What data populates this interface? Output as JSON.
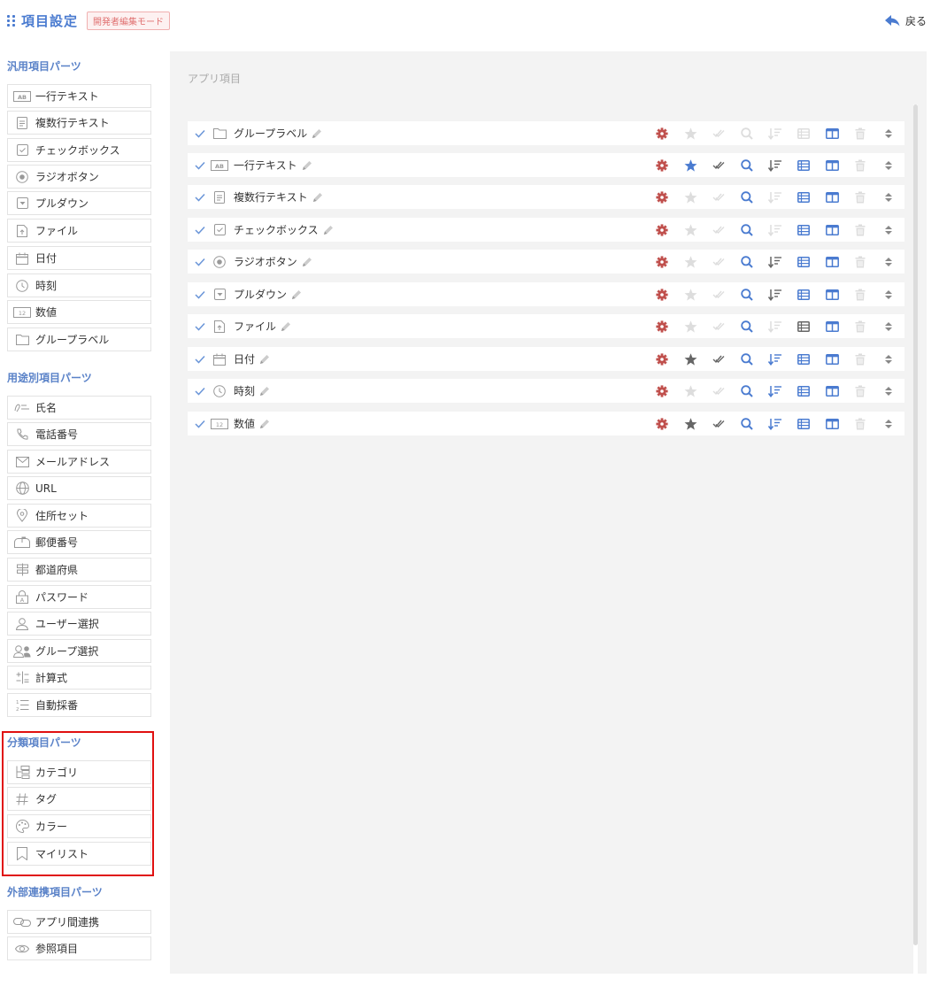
{
  "header": {
    "title": "項目設定",
    "mode_badge": "開発者編集モード",
    "back_label": "戻る"
  },
  "colors": {
    "accent": "#4a7bd0",
    "section": "#5a82c8",
    "gear": "#c0504d",
    "highlight": "#e01010",
    "icon_active": "#4a7bd0",
    "icon_dark": "#666666",
    "icon_disabled": "#dddddd"
  },
  "sidebar": {
    "sections": [
      {
        "title": "汎用項目パーツ",
        "items": [
          {
            "label": "一行テキスト",
            "icon": "text-line-icon"
          },
          {
            "label": "複数行テキスト",
            "icon": "multiline-text-icon"
          },
          {
            "label": "チェックボックス",
            "icon": "checkbox-icon"
          },
          {
            "label": "ラジオボタン",
            "icon": "radio-icon"
          },
          {
            "label": "プルダウン",
            "icon": "dropdown-icon"
          },
          {
            "label": "ファイル",
            "icon": "file-icon"
          },
          {
            "label": "日付",
            "icon": "calendar-icon"
          },
          {
            "label": "時刻",
            "icon": "clock-icon"
          },
          {
            "label": "数値",
            "icon": "number-icon"
          },
          {
            "label": "グループラベル",
            "icon": "folder-icon"
          }
        ]
      },
      {
        "title": "用途別項目パーツ",
        "items": [
          {
            "label": "氏名",
            "icon": "name-icon"
          },
          {
            "label": "電話番号",
            "icon": "phone-icon"
          },
          {
            "label": "メールアドレス",
            "icon": "mail-icon"
          },
          {
            "label": "URL",
            "icon": "globe-icon"
          },
          {
            "label": "住所セット",
            "icon": "location-icon"
          },
          {
            "label": "郵便番号",
            "icon": "postbox-icon"
          },
          {
            "label": "都道府県",
            "icon": "signpost-icon"
          },
          {
            "label": "パスワード",
            "icon": "password-icon"
          },
          {
            "label": "ユーザー選択",
            "icon": "user-icon"
          },
          {
            "label": "グループ選択",
            "icon": "group-icon"
          },
          {
            "label": "計算式",
            "icon": "calculator-icon"
          },
          {
            "label": "自動採番",
            "icon": "numbering-icon"
          }
        ]
      },
      {
        "title": "分類項目パーツ",
        "items": [
          {
            "label": "カテゴリ",
            "icon": "category-tree-icon"
          },
          {
            "label": "タグ",
            "icon": "hash-icon"
          },
          {
            "label": "カラー",
            "icon": "palette-icon"
          },
          {
            "label": "マイリスト",
            "icon": "bookmark-icon"
          }
        ]
      },
      {
        "title": "外部連携項目パーツ",
        "items": [
          {
            "label": "アプリ間連携",
            "icon": "link-icon"
          },
          {
            "label": "参照項目",
            "icon": "eye-icon"
          }
        ]
      }
    ]
  },
  "main": {
    "title": "アプリ項目",
    "fields": [
      {
        "label": "グループラベル",
        "icon": "folder-icon",
        "states": [
          "gear",
          "off",
          "off",
          "off",
          "off",
          "off",
          "on",
          "off",
          "sort"
        ]
      },
      {
        "label": "一行テキスト",
        "icon": "text-line-icon",
        "states": [
          "gear",
          "on",
          "dark",
          "on",
          "dark",
          "on",
          "on",
          "off",
          "sort"
        ]
      },
      {
        "label": "複数行テキスト",
        "icon": "multiline-text-icon",
        "states": [
          "gear",
          "off",
          "off",
          "on",
          "off",
          "on",
          "on",
          "off",
          "sort"
        ]
      },
      {
        "label": "チェックボックス",
        "icon": "checkbox-icon",
        "states": [
          "gear",
          "off",
          "off",
          "on",
          "off",
          "on",
          "on",
          "off",
          "sort"
        ]
      },
      {
        "label": "ラジオボタン",
        "icon": "radio-icon",
        "states": [
          "gear",
          "off",
          "off",
          "on",
          "dark",
          "on",
          "on",
          "off",
          "sort"
        ]
      },
      {
        "label": "プルダウン",
        "icon": "dropdown-icon",
        "states": [
          "gear",
          "off",
          "off",
          "on",
          "dark",
          "on",
          "on",
          "off",
          "sort"
        ]
      },
      {
        "label": "ファイル",
        "icon": "file-icon",
        "states": [
          "gear",
          "off",
          "off",
          "on",
          "off",
          "dark",
          "on",
          "off",
          "sort"
        ]
      },
      {
        "label": "日付",
        "icon": "calendar-icon",
        "states": [
          "gear",
          "dark",
          "dark",
          "on",
          "on",
          "on",
          "on",
          "off",
          "sort"
        ]
      },
      {
        "label": "時刻",
        "icon": "clock-icon",
        "states": [
          "gear",
          "off",
          "off",
          "on",
          "on",
          "on",
          "on",
          "off",
          "sort"
        ]
      },
      {
        "label": "数値",
        "icon": "number-icon",
        "states": [
          "gear",
          "dark",
          "dark",
          "on",
          "on",
          "on",
          "on",
          "off",
          "sort"
        ]
      }
    ],
    "action_icons": [
      "gear-icon",
      "star-icon",
      "double-check-icon",
      "search-icon",
      "sort-icon",
      "list-icon",
      "columns-icon",
      "trash-icon",
      "reorder-icon"
    ]
  }
}
